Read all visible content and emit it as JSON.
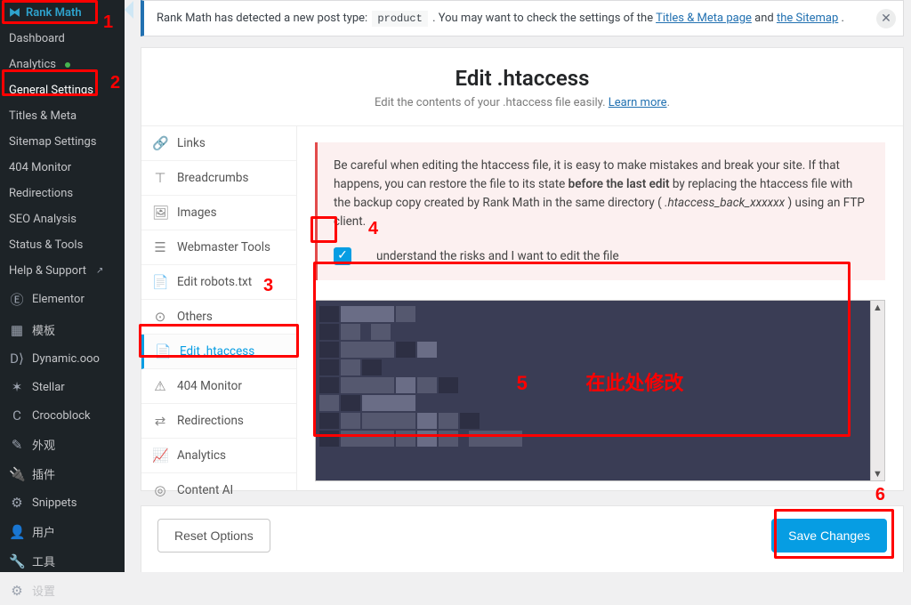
{
  "sidebar": {
    "rankmath_label": "Rank Math",
    "submenu": [
      {
        "label": "Dashboard"
      },
      {
        "label": "Analytics",
        "dot": true
      },
      {
        "label": "General Settings"
      },
      {
        "label": "Titles & Meta"
      },
      {
        "label": "Sitemap Settings"
      },
      {
        "label": "404 Monitor"
      },
      {
        "label": "Redirections"
      },
      {
        "label": "SEO Analysis"
      },
      {
        "label": "Status & Tools"
      },
      {
        "label": "Help & Support",
        "ext": true
      }
    ],
    "menu": [
      {
        "icon": "Ⓔ",
        "label": "Elementor"
      },
      {
        "icon": "▦",
        "label": "模板"
      },
      {
        "icon": "D⟩",
        "label": "Dynamic.ooo"
      },
      {
        "icon": "✶",
        "label": "Stellar"
      },
      {
        "icon": "C",
        "label": "Crocoblock"
      },
      {
        "icon": "✎",
        "label": "外观"
      },
      {
        "icon": "🔌",
        "label": "插件"
      },
      {
        "icon": "⚙",
        "label": "Snippets"
      },
      {
        "icon": "👤",
        "label": "用户"
      },
      {
        "icon": "🔧",
        "label": "工具"
      },
      {
        "icon": "⚙",
        "label": "设置"
      }
    ]
  },
  "notice": {
    "text_pre": "Rank Math has detected a new post type: ",
    "code": "product",
    "text_mid": " . You may want to check the settings of the ",
    "link1": "Titles & Meta page",
    "text_and": " and ",
    "link2": "the Sitemap",
    "text_post": "."
  },
  "page": {
    "title": "Edit .htaccess",
    "subtitle_pre": "Edit the contents of your .htaccess file easily. ",
    "learn_more": "Learn more",
    "subtitle_post": "."
  },
  "tabs": [
    {
      "icon": "🔗",
      "label": "Links"
    },
    {
      "icon": "⊤",
      "label": "Breadcrumbs"
    },
    {
      "icon": "🖼",
      "label": "Images"
    },
    {
      "icon": "☰",
      "label": "Webmaster Tools"
    },
    {
      "icon": "📄",
      "label": "Edit robots.txt"
    },
    {
      "icon": "⊙",
      "label": "Others"
    },
    {
      "icon": "📄",
      "label": "Edit .htaccess",
      "active": true
    },
    {
      "icon": "⚠",
      "label": "404 Monitor"
    },
    {
      "icon": "⇄",
      "label": "Redirections"
    },
    {
      "icon": "📈",
      "label": "Analytics"
    },
    {
      "icon": "◎",
      "label": "Content AI"
    }
  ],
  "warning": {
    "p1a": "Be careful when editing the htaccess file, it is easy to make mistakes and break your site. If that happens, you can restore the file to its state ",
    "p1b": "before the last edit",
    "p1c": " by replacing the htaccess file with the backup copy created by Rank Math in the same directory (",
    "p1d": ".htaccess_back_xxxxxx",
    "p1e": ") using an FTP client.",
    "risk_label": "understand the risks and I want to edit the file",
    "risk_checked": true
  },
  "editor_caption": "在此处修改",
  "actions": {
    "reset": "Reset Options",
    "save": "Save Changes"
  },
  "annotations": {
    "n1": "1",
    "n2": "2",
    "n3": "3",
    "n4": "4",
    "n5": "5",
    "n6": "6"
  }
}
